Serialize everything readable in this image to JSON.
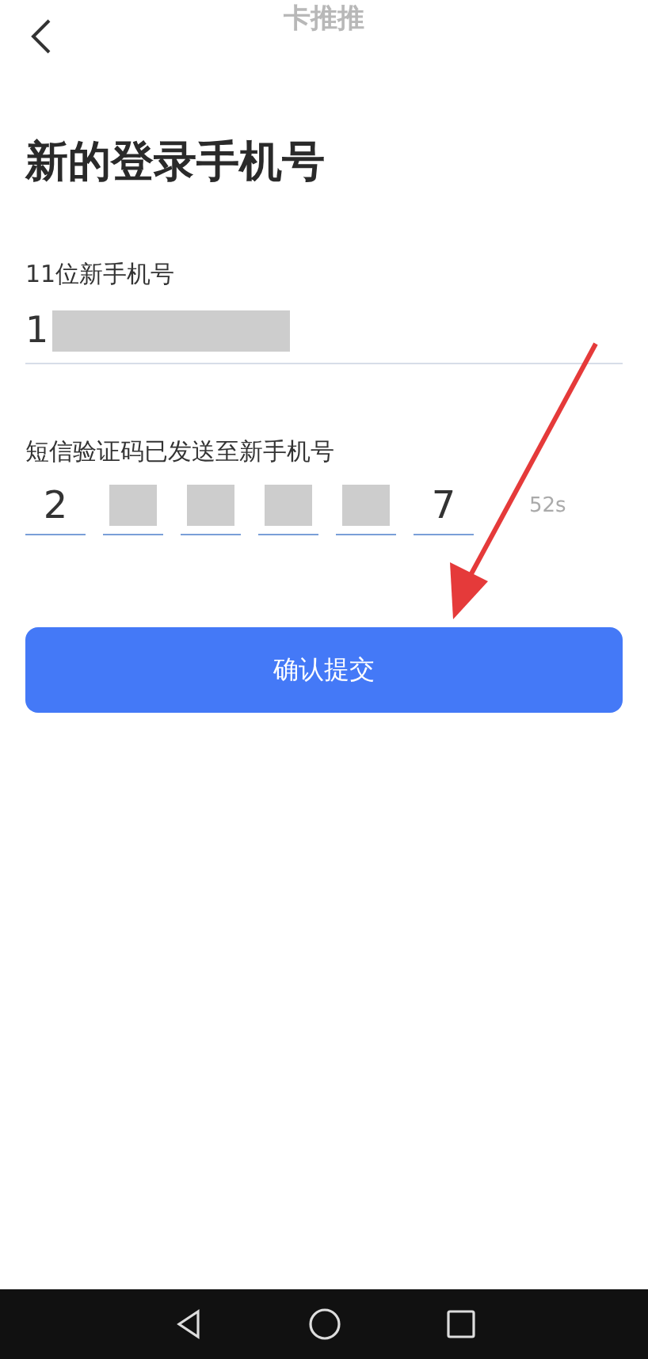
{
  "header": {
    "title": "卡推推"
  },
  "page_title": "新的登录手机号",
  "phone": {
    "label": "11位新手机号",
    "value": "1",
    "masked": true
  },
  "code": {
    "label": "短信验证码已发送至新手机号",
    "countdown": "52s",
    "cells": [
      {
        "digit": "2",
        "masked": false
      },
      {
        "masked": true
      },
      {
        "masked": true
      },
      {
        "masked": true
      },
      {
        "masked": true
      },
      {
        "digit": "7",
        "masked": false
      }
    ]
  },
  "submit": {
    "label": "确认提交"
  },
  "annotation": {
    "kind": "arrow"
  },
  "nav_bar": {
    "buttons": [
      {
        "kind": "back"
      },
      {
        "kind": "home"
      },
      {
        "kind": "recents"
      }
    ]
  }
}
